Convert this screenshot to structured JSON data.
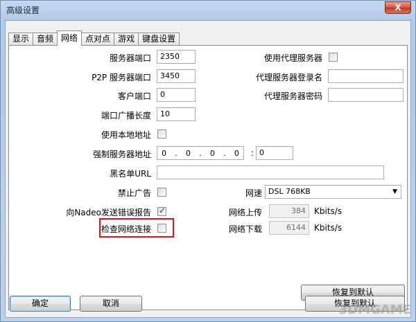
{
  "window": {
    "title": "高级设置",
    "close_label": "X"
  },
  "tabs": [
    {
      "label": "显示"
    },
    {
      "label": "音频"
    },
    {
      "label": "网络"
    },
    {
      "label": "点对点"
    },
    {
      "label": "游戏"
    },
    {
      "label": "键盘设置"
    }
  ],
  "active_tab": "网络",
  "left": {
    "server_port": {
      "label": "服务器端口",
      "value": "2350"
    },
    "p2p_port": {
      "label": "P2P 服务器端口",
      "value": "3450"
    },
    "client_port": {
      "label": "客户端口",
      "value": "0"
    },
    "broadcast_length": {
      "label": "端口广播长度",
      "value": "10"
    },
    "use_local_address": {
      "label": "使用本地地址",
      "checked": false
    },
    "force_server_address": {
      "label": "强制服务器地址",
      "ip": [
        "0",
        "0",
        "0",
        "0"
      ],
      "port": "0"
    },
    "blacklist_url": {
      "label": "黑名单URL",
      "value": ""
    },
    "block_ads": {
      "label": "禁止广告",
      "checked": false
    },
    "send_error_reports": {
      "label": "向Nadeo发送错误报告",
      "checked": true
    },
    "check_connection": {
      "label": "检查网络连接",
      "checked": false
    }
  },
  "right": {
    "use_proxy": {
      "label": "使用代理服务器",
      "checked": false
    },
    "proxy_login": {
      "label": "代理服务器登录名",
      "value": ""
    },
    "proxy_password": {
      "label": "代理服务器密码",
      "value": ""
    },
    "net_speed": {
      "label": "网速",
      "selected": "DSL 768KB"
    },
    "upload": {
      "label": "网络上传",
      "value": "384",
      "unit": "Kbits/s"
    },
    "download": {
      "label": "网络下载",
      "value": "6144",
      "unit": "Kbits/s"
    },
    "restore_default_label": "恢复到默认"
  },
  "footer": {
    "ok_label": "确定",
    "cancel_label": "取消",
    "restore_default_label": "恢复到默认"
  },
  "watermark": "3DMGAME",
  "colors": {
    "highlight": "#e0141b",
    "title_bar": "#b4cbe6"
  }
}
